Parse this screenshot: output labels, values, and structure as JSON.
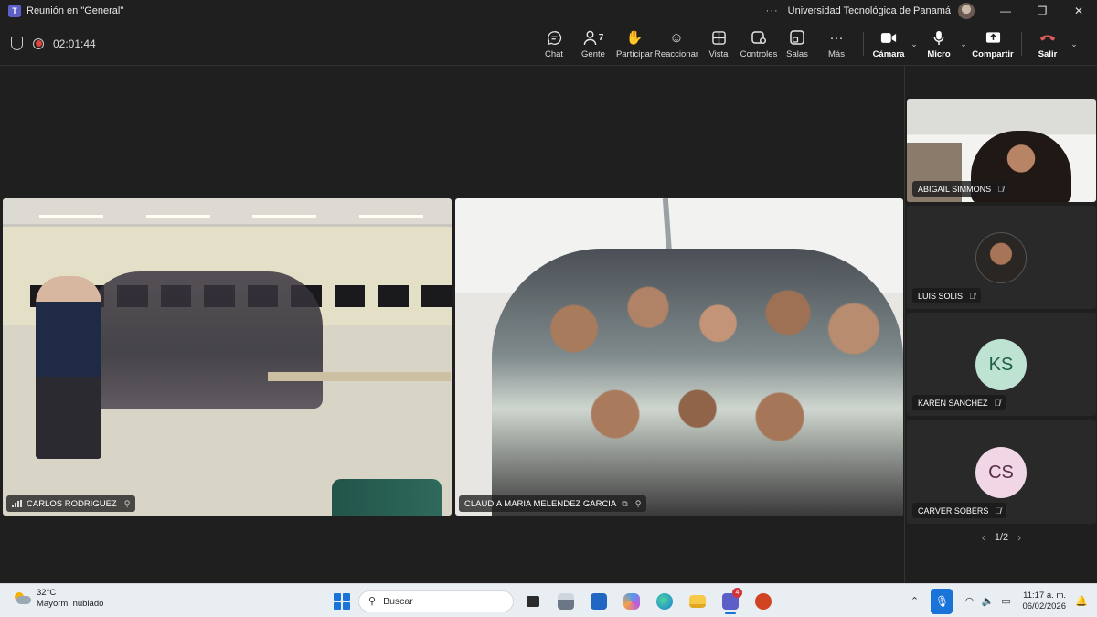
{
  "window": {
    "title": "Reunión en \"General\"",
    "org": "Universidad Tecnológica de Panamá",
    "more": "···"
  },
  "meeting": {
    "timer": "02:01:44",
    "toolbar": {
      "chat": "Chat",
      "people": "Gente",
      "people_count": "7",
      "raise": "Participar",
      "react": "Reaccionar",
      "view": "Vista",
      "controls": "Controles",
      "rooms": "Salas",
      "more": "Más",
      "camera": "Cámara",
      "mic": "Micro",
      "share": "Compartir",
      "leave": "Salir"
    }
  },
  "stage": {
    "tiles": [
      {
        "name": "CARLOS RODRIGUEZ"
      },
      {
        "name": "CLAUDIA MARIA MELENDEZ GARCIA"
      }
    ]
  },
  "rail": {
    "participants": [
      {
        "name": "ABIGAIL SIMMONS",
        "muted": true,
        "video": true
      },
      {
        "name": "LUIS SOLIS",
        "muted": true,
        "avatar": "photo"
      },
      {
        "name": "KAREN SANCHEZ",
        "muted": true,
        "initials": "KS",
        "color": "#bfe3d3"
      },
      {
        "name": "CARVER SOBERS",
        "muted": true,
        "initials": "CS",
        "color": "#f1d6e6"
      }
    ],
    "pager": "1/2"
  },
  "taskbar": {
    "weather_temp": "32°C",
    "weather_desc": "Mayorm. nublado",
    "search_placeholder": "Buscar",
    "teams_badge": "4",
    "time": "11:17 a. m.",
    "date": "06/02/2026"
  }
}
